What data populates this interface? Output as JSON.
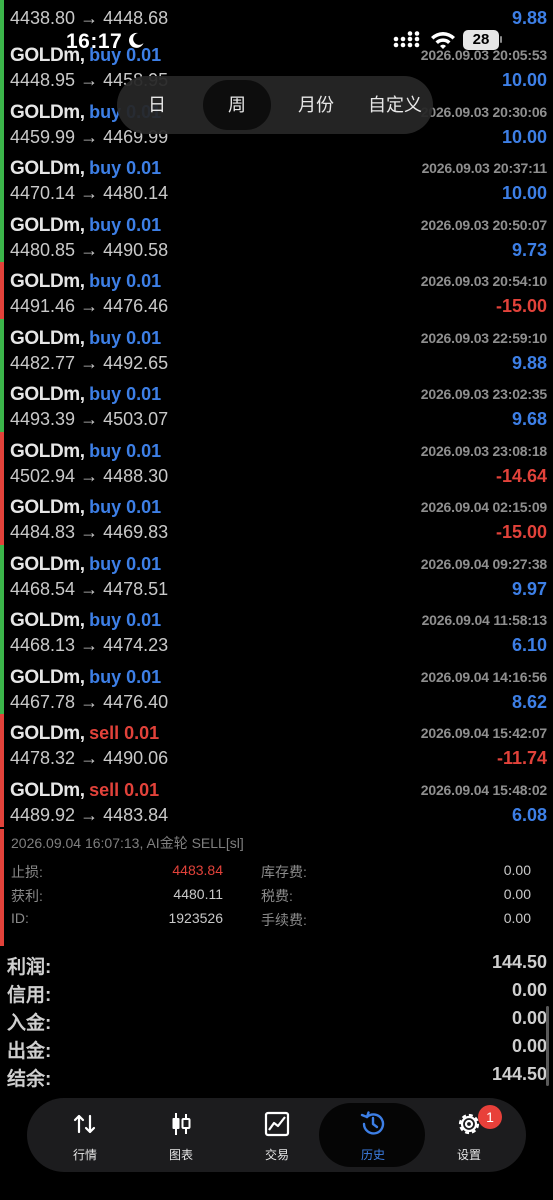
{
  "status_bar": {
    "time": "16:17",
    "battery": "28"
  },
  "period_tabs": [
    {
      "label": "日",
      "active": false
    },
    {
      "label": "周",
      "active": true
    },
    {
      "label": "月份",
      "active": false
    },
    {
      "label": "自定义",
      "active": false
    }
  ],
  "trade_top": {
    "prices": "4438.80 → 4448.68",
    "profit": "9.88"
  },
  "trades": [
    {
      "symbol": "GOLDm,",
      "direction": "buy 0.01",
      "time": "2026.09.03 20:05:53",
      "prices": "4448.95 → 4458.95",
      "profit": "10.00"
    },
    {
      "symbol": "GOLDm,",
      "direction": "buy 0.01",
      "time": "2026.09.03 20:30:06",
      "prices": "4459.99 → 4469.99",
      "profit": "10.00"
    },
    {
      "symbol": "GOLDm,",
      "direction": "buy 0.01",
      "time": "2026.09.03 20:37:11",
      "prices": "4470.14 → 4480.14",
      "profit": "10.00"
    },
    {
      "symbol": "GOLDm,",
      "direction": "buy 0.01",
      "time": "2026.09.03 20:50:07",
      "prices": "4480.85 → 4490.58",
      "profit": "9.73"
    },
    {
      "symbol": "GOLDm,",
      "direction": "buy 0.01",
      "time": "2026.09.03 20:54:10",
      "prices": "4491.46 → 4476.46",
      "profit": "-15.00"
    },
    {
      "symbol": "GOLDm,",
      "direction": "buy 0.01",
      "time": "2026.09.03 22:59:10",
      "prices": "4482.77 → 4492.65",
      "profit": "9.88"
    },
    {
      "symbol": "GOLDm,",
      "direction": "buy 0.01",
      "time": "2026.09.03 23:02:35",
      "prices": "4493.39 → 4503.07",
      "profit": "9.68"
    },
    {
      "symbol": "GOLDm,",
      "direction": "buy 0.01",
      "time": "2026.09.03 23:08:18",
      "prices": "4502.94 → 4488.30",
      "profit": "-14.64"
    },
    {
      "symbol": "GOLDm,",
      "direction": "buy 0.01",
      "time": "2026.09.04 02:15:09",
      "prices": "4484.83 → 4469.83",
      "profit": "-15.00"
    },
    {
      "symbol": "GOLDm,",
      "direction": "buy 0.01",
      "time": "2026.09.04 09:27:38",
      "prices": "4468.54 → 4478.51",
      "profit": "9.97"
    },
    {
      "symbol": "GOLDm,",
      "direction": "buy 0.01",
      "time": "2026.09.04 11:58:13",
      "prices": "4468.13 → 4474.23",
      "profit": "6.10"
    },
    {
      "symbol": "GOLDm,",
      "direction": "buy 0.01",
      "time": "2026.09.04 14:16:56",
      "prices": "4467.78 → 4476.40",
      "profit": "8.62"
    },
    {
      "symbol": "GOLDm,",
      "direction": "sell 0.01",
      "time": "2026.09.04 15:42:07",
      "prices": "4478.32 → 4490.06",
      "profit": "-11.74"
    },
    {
      "symbol": "GOLDm,",
      "direction": "sell 0.01",
      "time": "2026.09.04 15:48:02",
      "prices": "4489.92 → 4483.84",
      "profit": "6.08"
    }
  ],
  "detail": {
    "comment": "2026.09.04 16:07:13, AI金轮 SELL[sl]",
    "rows": [
      {
        "label": "止损:",
        "value": "4483.84",
        "label2": "库存费:",
        "value2": "0.00"
      },
      {
        "label": "获利:",
        "value": "4480.11",
        "label2": "税费:",
        "value2": "0.00"
      },
      {
        "label": "ID:",
        "value": "1923526",
        "label2": "手续费:",
        "value2": "0.00"
      }
    ]
  },
  "summary": [
    {
      "label": "利润:",
      "value": "144.50"
    },
    {
      "label": "信用:",
      "value": "0.00"
    },
    {
      "label": "入金:",
      "value": "0.00"
    },
    {
      "label": "出金:",
      "value": "0.00"
    },
    {
      "label": "结余:",
      "value": "144.50"
    }
  ],
  "tabs": [
    {
      "label": "行情",
      "icon": "quotes-icon"
    },
    {
      "label": "图表",
      "icon": "chart-icon"
    },
    {
      "label": "交易",
      "icon": "trade-icon"
    },
    {
      "label": "历史",
      "icon": "history-icon"
    },
    {
      "label": "设置",
      "icon": "settings-icon"
    }
  ],
  "settings_badge": "1",
  "colors": {
    "profit": "#3d7fe6",
    "loss": "#e2423a",
    "win_bar": "#3bb54a",
    "loss_bar": "#e2423a"
  }
}
